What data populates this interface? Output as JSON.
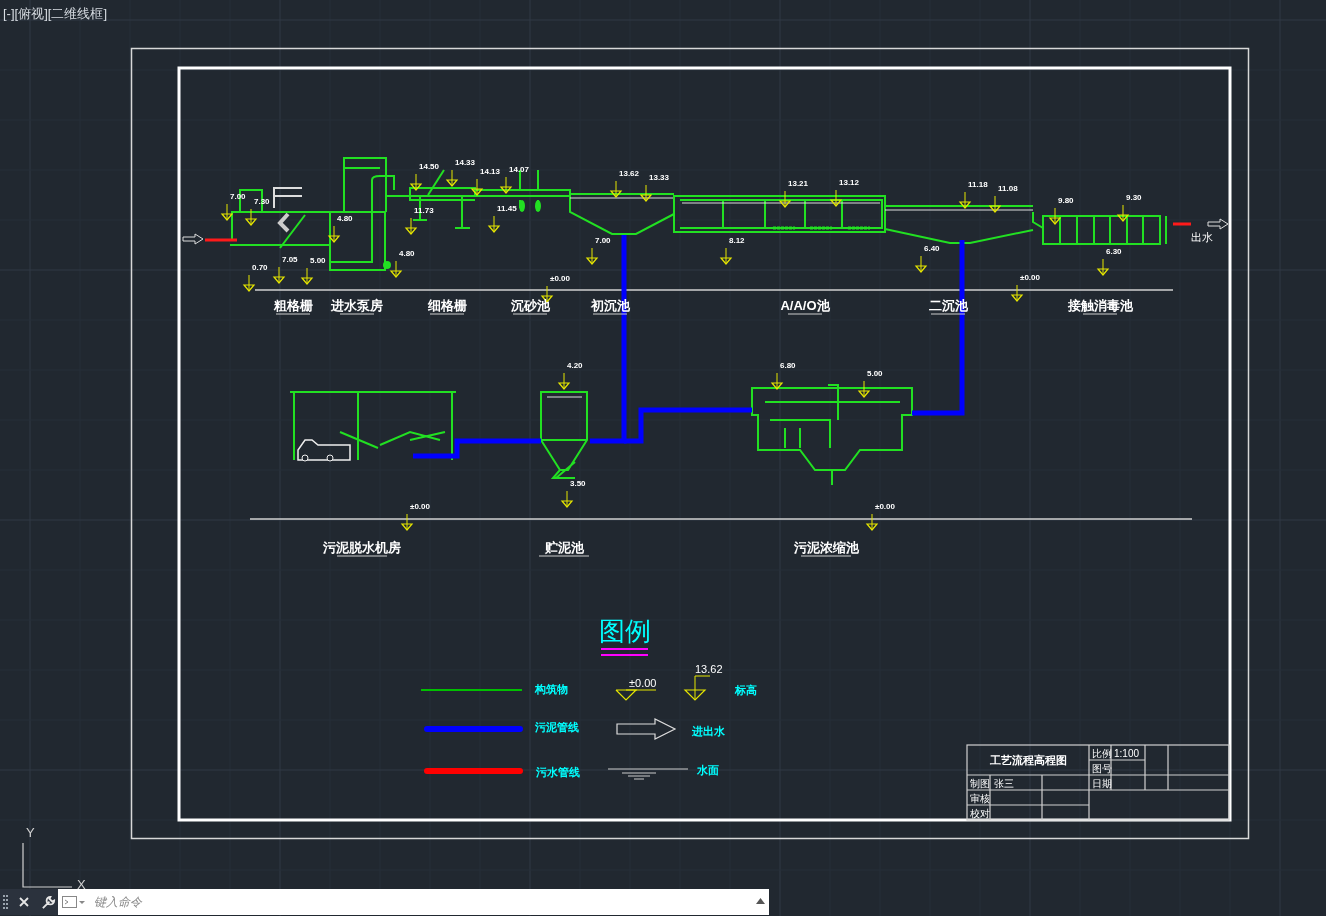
{
  "viewport_label": "[-][俯视][二维线框]",
  "process_units": [
    "粗格栅",
    "进水泵房",
    "细格栅",
    "沉砂池",
    "初沉池",
    "A/A/O池",
    "二沉池",
    "接触消毒池"
  ],
  "sludge_units": [
    "污泥脱水机房",
    "贮泥池",
    "污泥浓缩池"
  ],
  "elevations": [
    "7.00",
    "7.30",
    "0.70",
    "7.05",
    "5.00",
    "4.80",
    "4.80",
    "14.50",
    "14.33",
    "14.13",
    "14.07",
    "11.73",
    "11.45",
    "13.62",
    "13.33",
    "7.00",
    "±0.00",
    "13.21",
    "13.12",
    "8.12",
    "11.18",
    "11.08",
    "6.40",
    "9.80",
    "9.30",
    "6.30",
    "±0.00",
    "4.20",
    "3.50",
    "6.80",
    "5.00",
    "±0.00",
    "±0.00"
  ],
  "outlet_label": "出水",
  "legend": {
    "title": "图例",
    "items": [
      {
        "kind": "line",
        "color": "#00c000",
        "label": "构筑物"
      },
      {
        "kind": "pipe",
        "color": "#0000ff",
        "label": "污泥管线"
      },
      {
        "kind": "pipe",
        "color": "#ff0000",
        "label": "污水管线"
      },
      {
        "kind": "elevation",
        "texts": [
          "±0.00",
          "13.62"
        ],
        "label": "标高"
      },
      {
        "kind": "arrow",
        "label": "进出水"
      },
      {
        "kind": "water",
        "label": "水面"
      }
    ]
  },
  "title_block": {
    "title": "工艺流程高程图",
    "cells": [
      "比例",
      "1:100",
      "图号",
      "制图",
      "张三",
      "日期",
      "审核",
      "校对"
    ]
  },
  "ucs_axes": [
    "Y",
    "X"
  ],
  "command_line": {
    "placeholder": "键入命令"
  }
}
